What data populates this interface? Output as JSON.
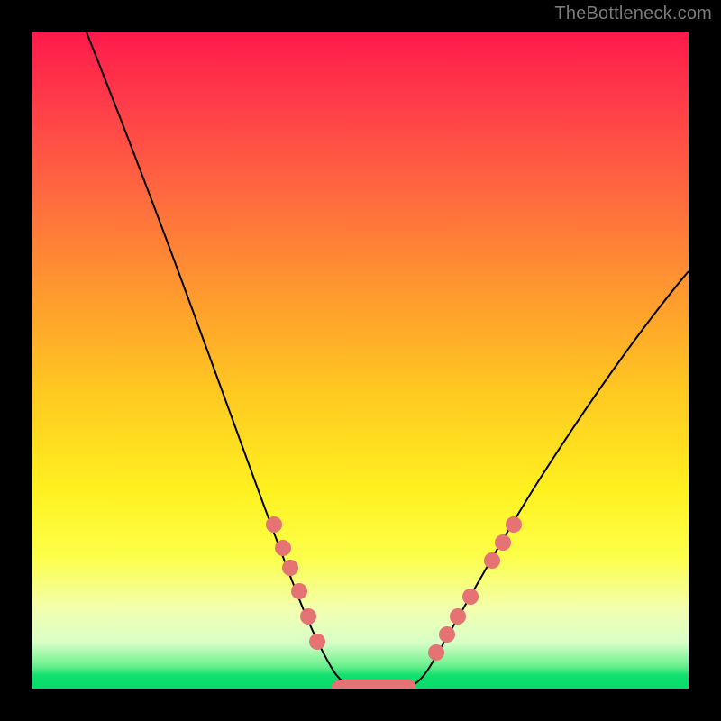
{
  "watermark": "TheBottleneck.com",
  "colors": {
    "background": "#000000",
    "gradient_stops": [
      "#ff1a4b",
      "#ff3a4a",
      "#ff6a3f",
      "#ff9a2e",
      "#ffc921",
      "#fff120",
      "#fcff4a",
      "#f2ffb0",
      "#d8ffc8",
      "#6cf08e",
      "#11e06f",
      "#06d96a"
    ],
    "curve": "#000000",
    "dots": "#e57373"
  },
  "chart_data": {
    "type": "line",
    "title": "",
    "xlabel": "",
    "ylabel": "",
    "xlim": [
      0,
      100
    ],
    "ylim": [
      0,
      100
    ],
    "series": [
      {
        "name": "bottleneck-curve",
        "x": [
          0,
          4,
          8,
          12,
          16,
          20,
          24,
          28,
          32,
          34,
          36,
          38,
          40,
          42,
          44,
          46,
          48,
          50,
          52,
          54,
          56,
          58,
          60,
          62,
          66,
          70,
          74,
          78,
          82,
          86,
          90,
          94,
          98,
          100
        ],
        "y": [
          100,
          93,
          85,
          77,
          69,
          61,
          53,
          45,
          37,
          32,
          27,
          22,
          17,
          12,
          7,
          3,
          1,
          0,
          0,
          1,
          3,
          7,
          12,
          17,
          25,
          32,
          39,
          45,
          51,
          56,
          60,
          63,
          65,
          66
        ]
      }
    ],
    "markers": {
      "name": "highlighted-points",
      "x": [
        36,
        37.5,
        39,
        40.5,
        42,
        43.5,
        58.5,
        60,
        61.5,
        63,
        65,
        67
      ],
      "y": [
        27,
        24,
        20,
        16,
        12,
        8,
        8,
        12,
        15,
        18,
        23,
        28
      ]
    },
    "flat_minimum": {
      "x_range": [
        46,
        56
      ],
      "y": 0
    },
    "legend": null,
    "grid": false,
    "annotations": []
  }
}
